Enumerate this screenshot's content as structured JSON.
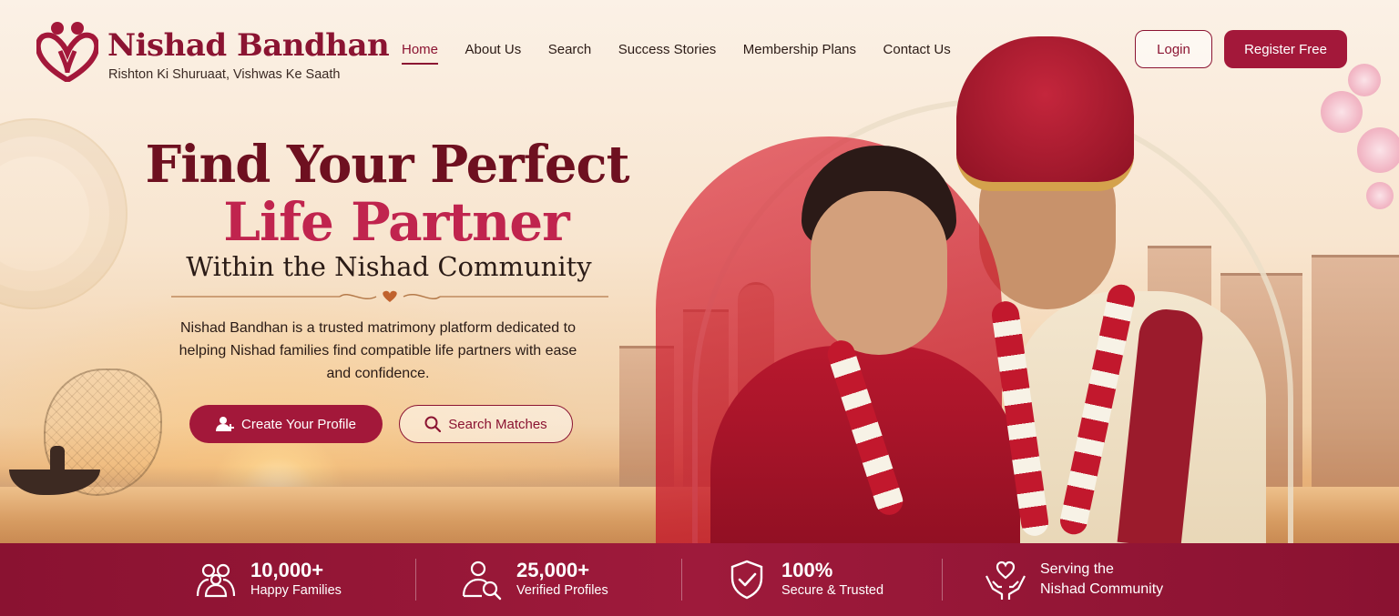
{
  "brand": {
    "name": "Nishad Bandhan",
    "tagline": "Rishton Ki Shuruaat, Vishwas Ke Saath",
    "logo_icon": "couple-heart-icon",
    "color": "#8b1432"
  },
  "nav": {
    "items": [
      {
        "label": "Home",
        "active": true
      },
      {
        "label": "About Us",
        "active": false
      },
      {
        "label": "Search",
        "active": false
      },
      {
        "label": "Success Stories",
        "active": false
      },
      {
        "label": "Membership Plans",
        "active": false
      },
      {
        "label": "Contact Us",
        "active": false
      }
    ],
    "login_label": "Login",
    "register_label": "Register Free"
  },
  "hero": {
    "title_line1": "Find Your Perfect",
    "title_line2": "Life Partner",
    "subtitle": "Within the Nishad Community",
    "description": "Nishad Bandhan is a trusted matrimony platform dedicated to helping Nishad families find compatible life partners with ease and confidence.",
    "create_profile_label": "Create Your Profile",
    "create_profile_icon": "add-user-icon",
    "search_matches_label": "Search Matches",
    "search_matches_icon": "search-icon"
  },
  "stats": [
    {
      "value": "10,000+",
      "label": "Happy Families",
      "icon": "family-icon"
    },
    {
      "value": "25,000+",
      "label": "Verified Profiles",
      "icon": "verified-users-icon"
    },
    {
      "value": "100%",
      "label": "Secure & Trusted",
      "icon": "shield-check-icon"
    },
    {
      "line1": "Serving the",
      "line2": "Nishad Community",
      "icon": "heart-hands-icon"
    }
  ],
  "colors": {
    "primary": "#a3183a",
    "title_dark": "#6e1020",
    "title_accent": "#c0244e",
    "stats_bar": "#8a1231"
  }
}
